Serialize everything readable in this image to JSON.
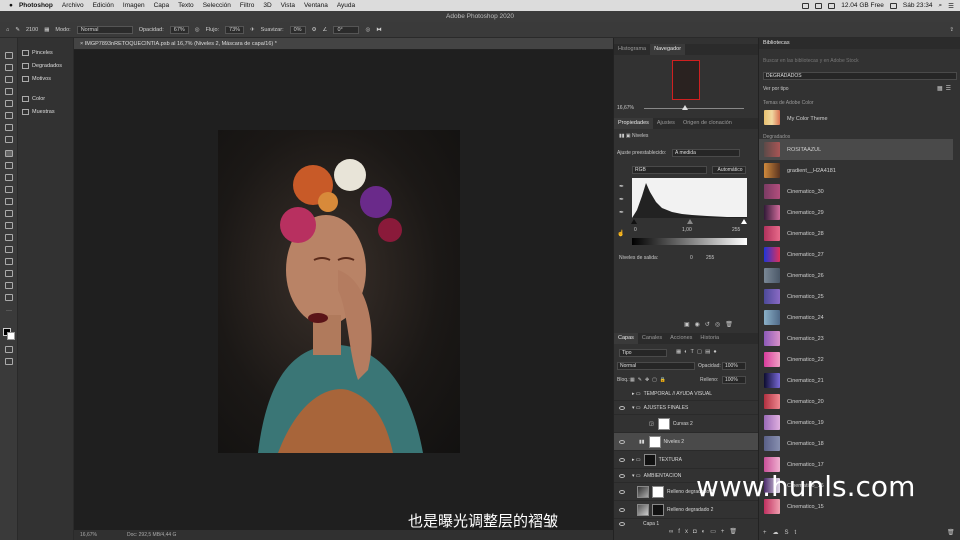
{
  "menubar": {
    "apple": "",
    "app": "Photoshop",
    "items": [
      "Archivo",
      "Edición",
      "Imagen",
      "Capa",
      "Texto",
      "Selección",
      "Filtro",
      "3D",
      "Vista",
      "Ventana",
      "Ayuda"
    ],
    "storage": "12.04 GB Free",
    "clock": "Sáb 23:34"
  },
  "window": {
    "title": "Adobe Photoshop 2020"
  },
  "options": {
    "size": "2100",
    "modo_label": "Modo:",
    "modo": "Normal",
    "opacidad_label": "Opacidad:",
    "opacidad": "67%",
    "flujo_label": "Flujo:",
    "flujo": "73%",
    "suavizar_label": "Suavizar:",
    "suavizar": "0%",
    "angle": "0°"
  },
  "minipanel": {
    "items": [
      "Pinceles",
      "Degradados",
      "Motivos",
      "Color",
      "Muestras"
    ]
  },
  "document": {
    "tab": "IMGP7893nRETOQUECINTIA.psb al 16,7% (Niveles 2, Máscara de capa/16) *",
    "zoom": "16,67%",
    "docsize": "Doc: 292,5 MB/4,44 G"
  },
  "navigator": {
    "tabs": [
      "Histograma",
      "Navegador"
    ],
    "zoom": "16,67%"
  },
  "properties": {
    "tabs": [
      "Propiedades",
      "Ajustes",
      "Origen de clonación"
    ],
    "layer_type": "Niveles",
    "preset_label": "Ajuste preestablecido:",
    "preset": "A medida",
    "channel": "RGB",
    "auto": "Automático",
    "input": [
      "0",
      "1,00",
      "255"
    ],
    "output_label": "Niveles de salida:",
    "output": [
      "0",
      "255"
    ]
  },
  "layers": {
    "tabs": [
      "Capas",
      "Canales",
      "Acciones",
      "Historia"
    ],
    "filter": "Tipo",
    "blend": "Normal",
    "opacity_label": "Opacidad:",
    "opacity": "100%",
    "lock_label": "Bloq.:",
    "fill_label": "Relleno:",
    "fill": "100%",
    "items": [
      {
        "name": "TEMPORAL // AYUDA VISUAL"
      },
      {
        "name": "AJUSTES FINALES"
      },
      {
        "name": "Curvas 2"
      },
      {
        "name": "Niveles 2"
      },
      {
        "name": "TEXTURA"
      },
      {
        "name": "AMBIENTACION"
      },
      {
        "name": "Relleno degradado 3"
      },
      {
        "name": "Relleno degradado 2"
      },
      {
        "name": "Capa 1"
      }
    ]
  },
  "libraries": {
    "tab": "Bibliotecas",
    "search": "Buscar en las bibliotecas y en Adobe Stock",
    "library": "DEGRADADOS",
    "view": "Ver por tipo",
    "sec_color": "Temas de Adobe Color",
    "color_theme": "My Color Theme",
    "sec_grad": "Degradados",
    "items": [
      {
        "name": "ROSITAAZUL",
        "c1": "#5c4a48",
        "c2": "#a95555"
      },
      {
        "name": "gradient__H2A4181",
        "c1": "#d08a3c",
        "c2": "#5b3420"
      },
      {
        "name": "Cinematico_30",
        "c1": "#7a3b63",
        "c2": "#b34e7d"
      },
      {
        "name": "Cinematico_29",
        "c1": "#321a38",
        "c2": "#d26c9c"
      },
      {
        "name": "Cinematico_28",
        "c1": "#b0325c",
        "c2": "#e86a8a"
      },
      {
        "name": "Cinematico_27",
        "c1": "#2035d8",
        "c2": "#e0305a"
      },
      {
        "name": "Cinematico_26",
        "c1": "#7a8896",
        "c2": "#4b5868"
      },
      {
        "name": "Cinematico_25",
        "c1": "#4c4a9a",
        "c2": "#8a6ac4"
      },
      {
        "name": "Cinematico_24",
        "c1": "#8ab0c8",
        "c2": "#506a88"
      },
      {
        "name": "Cinematico_23",
        "c1": "#8c5ab8",
        "c2": "#d890c8"
      },
      {
        "name": "Cinematico_22",
        "c1": "#d83c9c",
        "c2": "#f0a0c4"
      },
      {
        "name": "Cinematico_21",
        "c1": "#0c0c30",
        "c2": "#7a6ad8"
      },
      {
        "name": "Cinematico_20",
        "c1": "#b03040",
        "c2": "#f08890"
      },
      {
        "name": "Cinematico_19",
        "c1": "#9a6ab8",
        "c2": "#e0b0e0"
      },
      {
        "name": "Cinematico_18",
        "c1": "#5a6088",
        "c2": "#8890b0"
      },
      {
        "name": "Cinematico_17",
        "c1": "#c85098",
        "c2": "#f0b0d0"
      },
      {
        "name": "Cinematico_16",
        "c1": "#4a2a6a",
        "c2": "#e8e0f0"
      },
      {
        "name": "Cinematico_15",
        "c1": "#c03060",
        "c2": "#f0a0b0"
      }
    ]
  },
  "subtitle": "也是曝光调整层的褶皱",
  "watermark": "www.hunls.com"
}
